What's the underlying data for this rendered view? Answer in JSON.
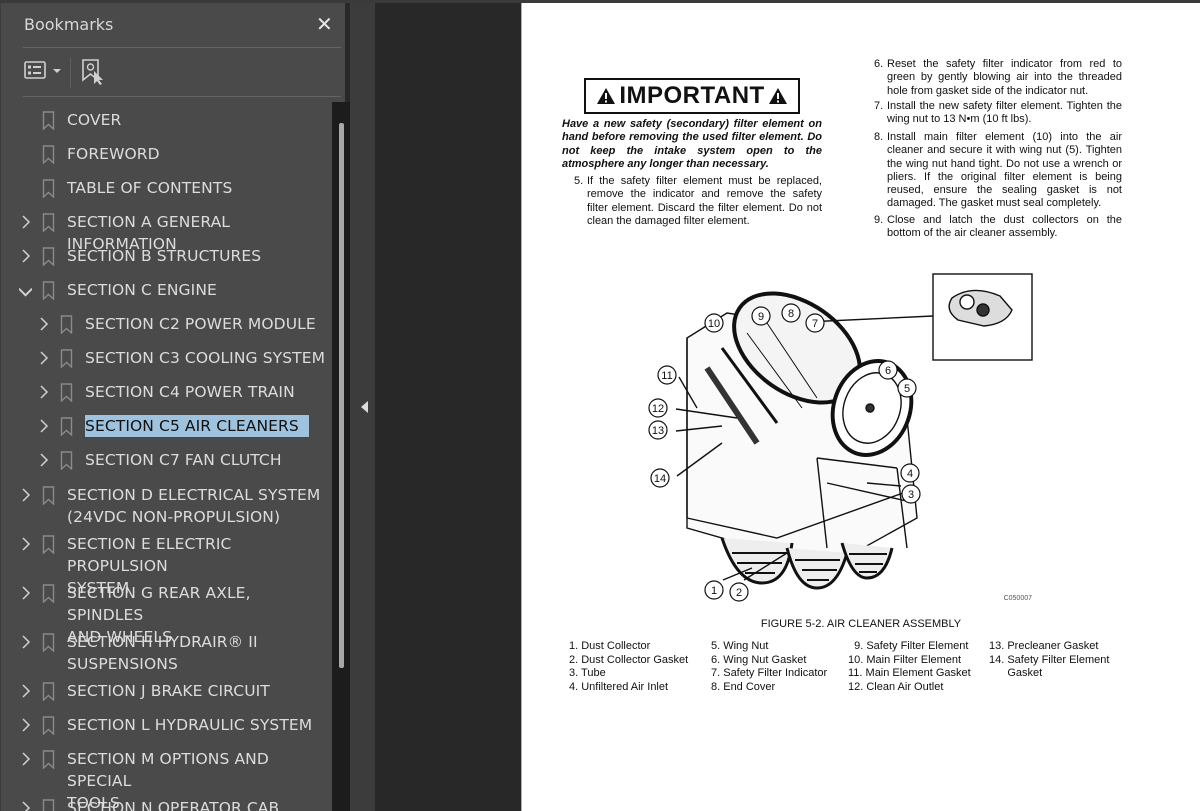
{
  "sidebar": {
    "title": "Bookmarks",
    "close_icon": "close-icon",
    "toolbar": {
      "options_icon": "list-options-icon",
      "new_bookmark_icon": "new-bookmark-icon"
    },
    "items": [
      {
        "label": "COVER",
        "level": 0,
        "expander": "none"
      },
      {
        "label": "FOREWORD",
        "level": 0,
        "expander": "none"
      },
      {
        "label": "TABLE OF CONTENTS",
        "level": 0,
        "expander": "none"
      },
      {
        "label": "SECTION A GENERAL INFORMATION",
        "level": 0,
        "expander": "collapsed"
      },
      {
        "label": "SECTION B STRUCTURES",
        "level": 0,
        "expander": "collapsed"
      },
      {
        "label": "SECTION C ENGINE",
        "level": 0,
        "expander": "expanded"
      },
      {
        "label": "SECTION C2 POWER MODULE",
        "level": 1,
        "expander": "collapsed"
      },
      {
        "label": "SECTION C3 COOLING SYSTEM",
        "level": 1,
        "expander": "collapsed"
      },
      {
        "label": "SECTION C4 POWER TRAIN",
        "level": 1,
        "expander": "collapsed"
      },
      {
        "label": "SECTION C5 AIR CLEANERS",
        "level": 1,
        "expander": "collapsed",
        "selected": true
      },
      {
        "label": "SECTION C7 FAN CLUTCH",
        "level": 1,
        "expander": "collapsed"
      },
      {
        "label": "SECTION D ELECTRICAL SYSTEM\n(24VDC NON-PROPULSION)",
        "level": 0,
        "expander": "collapsed"
      },
      {
        "label": "SECTION E ELECTRIC PROPULSION\nSYSTEM",
        "level": 0,
        "expander": "collapsed"
      },
      {
        "label": "SECTION G REAR AXLE, SPINDLES\nAND WHEELS",
        "level": 0,
        "expander": "collapsed"
      },
      {
        "label": "SECTION H HYDRAIR® II\nSUSPENSIONS",
        "level": 0,
        "expander": "collapsed"
      },
      {
        "label": "SECTION J BRAKE CIRCUIT",
        "level": 0,
        "expander": "collapsed"
      },
      {
        "label": "SECTION L HYDRAULIC SYSTEM",
        "level": 0,
        "expander": "collapsed"
      },
      {
        "label": "SECTION M OPTIONS AND SPECIAL\nTOOLS",
        "level": 0,
        "expander": "collapsed"
      },
      {
        "label": "SECTION N OPERATOR CAB",
        "level": 0,
        "expander": "collapsed"
      }
    ]
  },
  "document": {
    "important_label": "IMPORTANT",
    "important_text": "Have a new safety (secondary) filter element on hand before removing the used filter element. Do not keep the intake system open to the atmosphere any longer than necessary.",
    "steps": [
      {
        "num": "5.",
        "text": "If the safety filter element must be replaced, remove the indicator and remove the safety filter element. Discard the filter element. Do not clean the damaged filter element."
      },
      {
        "num": "6.",
        "text": "Reset the safety filter indicator from red to green by gently blowing air into the threaded hole from gasket side of the indicator nut."
      },
      {
        "num": "7.",
        "text": "Install the new safety filter element. Tighten the wing nut to 13 N•m (10 ft lbs)."
      },
      {
        "num": "8.",
        "text": "Install main filter element (10) into the air cleaner and secure it with wing nut (5). Tighten the wing nut hand tight. Do not use a wrench or pliers. If the original filter element is being reused, ensure the sealing gasket is not damaged. The gasket must seal completely."
      },
      {
        "num": "9.",
        "text": "Close and latch the dust collectors on the bottom of the air cleaner assembly."
      }
    ],
    "figure": {
      "code": "C050007",
      "caption": "FIGURE 5-2.  AIR CLEANER ASSEMBLY",
      "callouts": [
        "1",
        "2",
        "3",
        "4",
        "5",
        "6",
        "7",
        "8",
        "9",
        "10",
        "11",
        "12",
        "13",
        "14"
      ],
      "legend_columns": [
        "1. Dust Collector\n2. Dust Collector Gasket\n3. Tube\n4. Unfiltered Air Inlet",
        "5. Wing Nut\n6. Wing Nut Gasket\n7. Safety Filter Indicator\n8. End Cover",
        "  9. Safety Filter Element\n10. Main Filter Element\n11. Main Element Gasket\n12. Clean Air Outlet",
        "13. Precleaner Gasket\n14. Safety Filter Element\n      Gasket"
      ]
    }
  }
}
